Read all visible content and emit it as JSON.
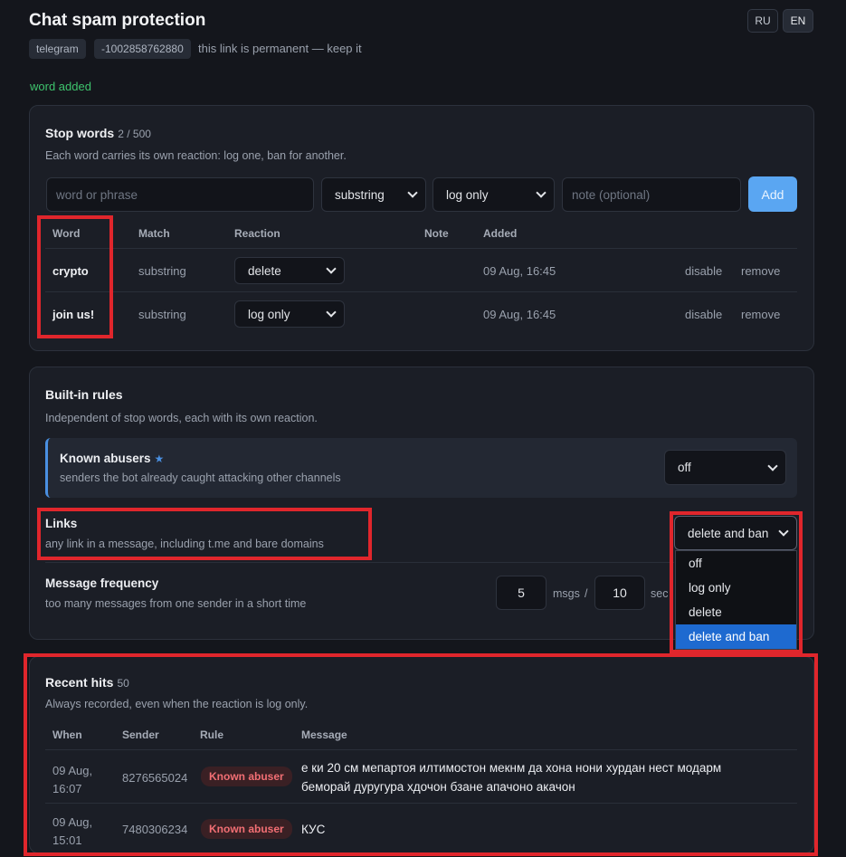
{
  "header": {
    "title": "Chat spam protection",
    "lang_ru": "RU",
    "lang_en": "EN",
    "chip_platform": "telegram",
    "chip_chat_id": "-1002858762880",
    "permanent_note": "this link is permanent — keep it",
    "flash": "word added"
  },
  "stopwords": {
    "title": "Stop words",
    "count": "2 / 500",
    "subtitle": "Each word carries its own reaction: log one, ban for another.",
    "input_placeholder": "word or phrase",
    "match_select": "substring",
    "reaction_select": "log only",
    "note_placeholder": "note (optional)",
    "add_label": "Add",
    "columns": [
      "Word",
      "Match",
      "Reaction",
      "Note",
      "Added"
    ],
    "rows": [
      {
        "word": "crypto",
        "match": "substring",
        "reaction": "delete",
        "note": "",
        "added": "09 Aug, 16:45",
        "disable": "disable",
        "remove": "remove"
      },
      {
        "word": "join us!",
        "match": "substring",
        "reaction": "log only",
        "note": "",
        "added": "09 Aug, 16:45",
        "disable": "disable",
        "remove": "remove"
      }
    ]
  },
  "builtin": {
    "title": "Built-in rules",
    "subtitle": "Independent of stop words, each with its own reaction.",
    "abusers_title": "Known abusers",
    "abusers_star": "★",
    "abusers_desc": "senders the bot already caught attacking other channels",
    "abusers_select": "off",
    "links_title": "Links",
    "links_desc": "any link in a message, including t.me and bare domains",
    "links_select": "delete and ban",
    "links_options": [
      "off",
      "log only",
      "delete",
      "delete and ban"
    ],
    "freq_title": "Message frequency",
    "freq_desc": "too many messages from one sender in a short time",
    "freq_msgs": "5",
    "freq_msgs_unit": "msgs",
    "freq_sep": "/",
    "freq_secs": "10",
    "freq_secs_unit": "sec"
  },
  "hits": {
    "title": "Recent hits",
    "count": "50",
    "subtitle": "Always recorded, even when the reaction is log only.",
    "columns": [
      "When",
      "Sender",
      "Rule",
      "Message"
    ],
    "rows": [
      {
        "when_date": "09 Aug,",
        "when_time": "16:07",
        "sender": "8276565024",
        "rule": "Known abuser",
        "message_line1": "е ки 20 см мепартоя илтимостон мекнм да хона нони хурдан нест модарм",
        "message_line2": "беморай дуругура хдочон бзане апачоно акачон"
      },
      {
        "when_date": "09 Aug,",
        "when_time": "15:01",
        "sender": "7480306234",
        "rule": "Known abuser",
        "message_line1": "КУС",
        "message_line2": ""
      }
    ]
  },
  "colors": {
    "accent": "#5aa6f2",
    "highlight": "#e0262c",
    "success": "#3ec46d",
    "badge_text": "#f26f74"
  }
}
